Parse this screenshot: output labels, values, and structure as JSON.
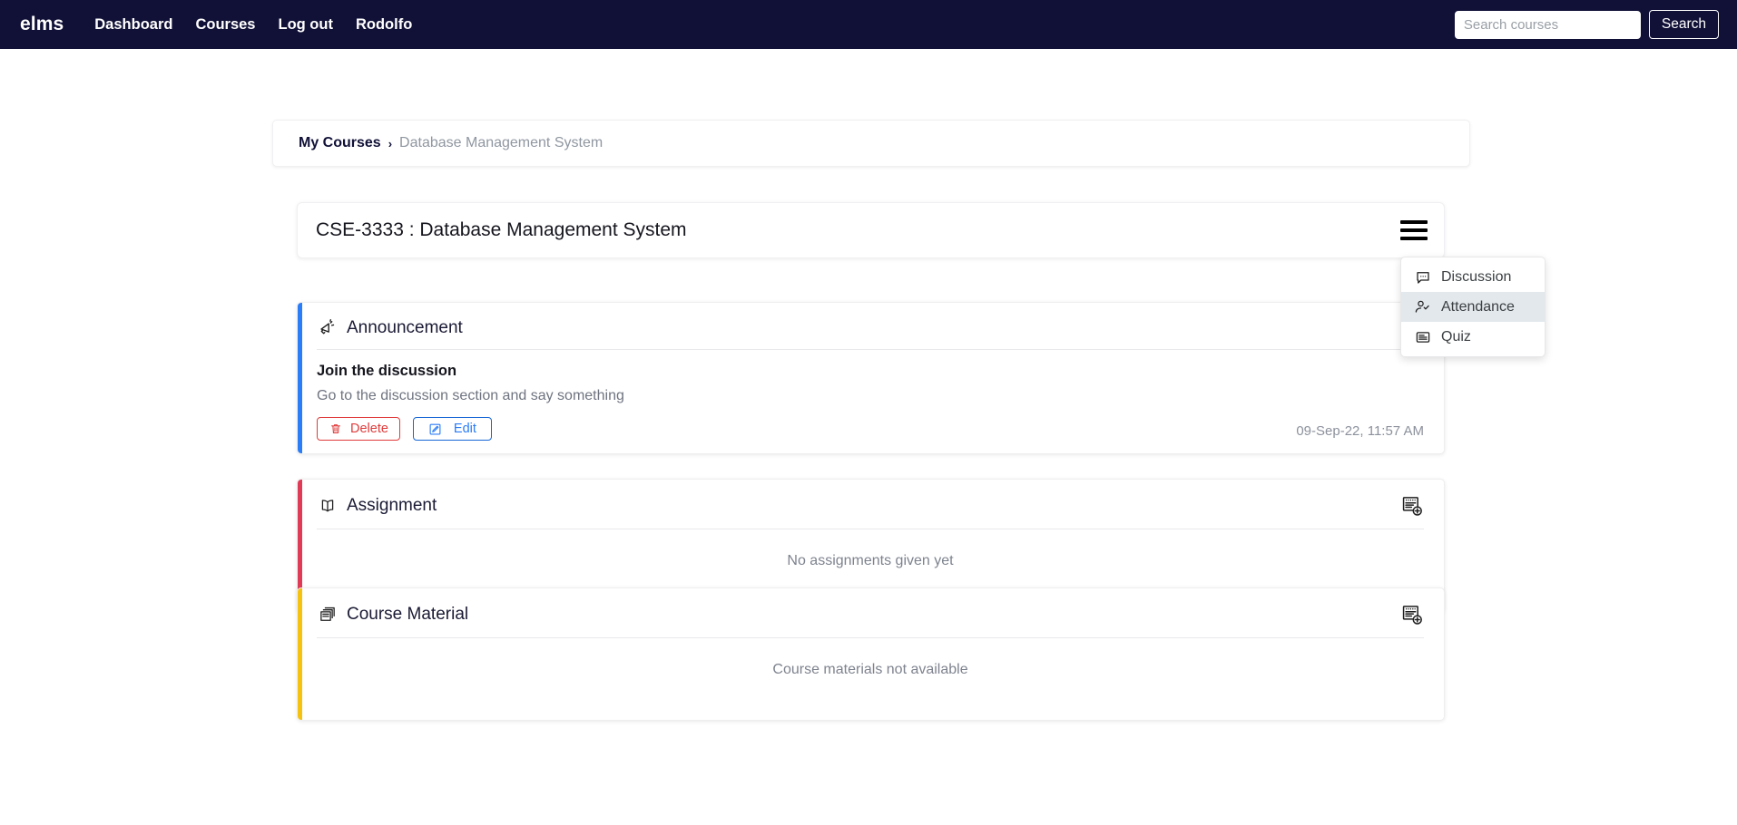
{
  "navbar": {
    "brand": "elms",
    "links": [
      {
        "label": "Dashboard",
        "name": "nav-link-dashboard"
      },
      {
        "label": "Courses",
        "name": "nav-link-courses"
      },
      {
        "label": "Log out",
        "name": "nav-link-logout"
      },
      {
        "label": "Rodolfo",
        "name": "nav-link-profile"
      }
    ],
    "search": {
      "placeholder": "Search courses",
      "value": "",
      "button_label": "Search"
    },
    "colors": {
      "background": "#111138",
      "text": "#ffffff"
    }
  },
  "breadcrumb": {
    "parent": "My Courses",
    "separator": "›",
    "current": "Database Management System"
  },
  "course": {
    "title": "CSE-3333 : Database Management System",
    "menu_icon": "hamburger-menu-icon"
  },
  "dropdown": {
    "items": [
      {
        "label": "Discussion",
        "icon": "chat-bubble-icon",
        "hovered": false
      },
      {
        "label": "Attendance",
        "icon": "person-check-icon",
        "hovered": true
      },
      {
        "label": "Quiz",
        "icon": "article-list-icon",
        "hovered": false
      }
    ]
  },
  "sections": {
    "announcement": {
      "title": "Announcement",
      "icon": "megaphone-icon",
      "accent_color": "#2a7cf7",
      "post": {
        "title": "Join the discussion",
        "body": "Go to the discussion section and say something",
        "timestamp": "09-Sep-22, 11:57 AM",
        "delete_label": "Delete",
        "delete_icon": "trash-icon",
        "edit_label": "Edit",
        "edit_icon": "edit-square-icon"
      }
    },
    "assignment": {
      "title": "Assignment",
      "icon": "open-book-icon",
      "accent_color": "#e03b56",
      "add_icon": "post-add-icon",
      "empty_text": "No assignments given yet"
    },
    "course_material": {
      "title": "Course Material",
      "icon": "file-box-icon",
      "accent_color": "#f5c211",
      "add_icon": "post-add-icon",
      "empty_text": "Course materials not available"
    }
  }
}
